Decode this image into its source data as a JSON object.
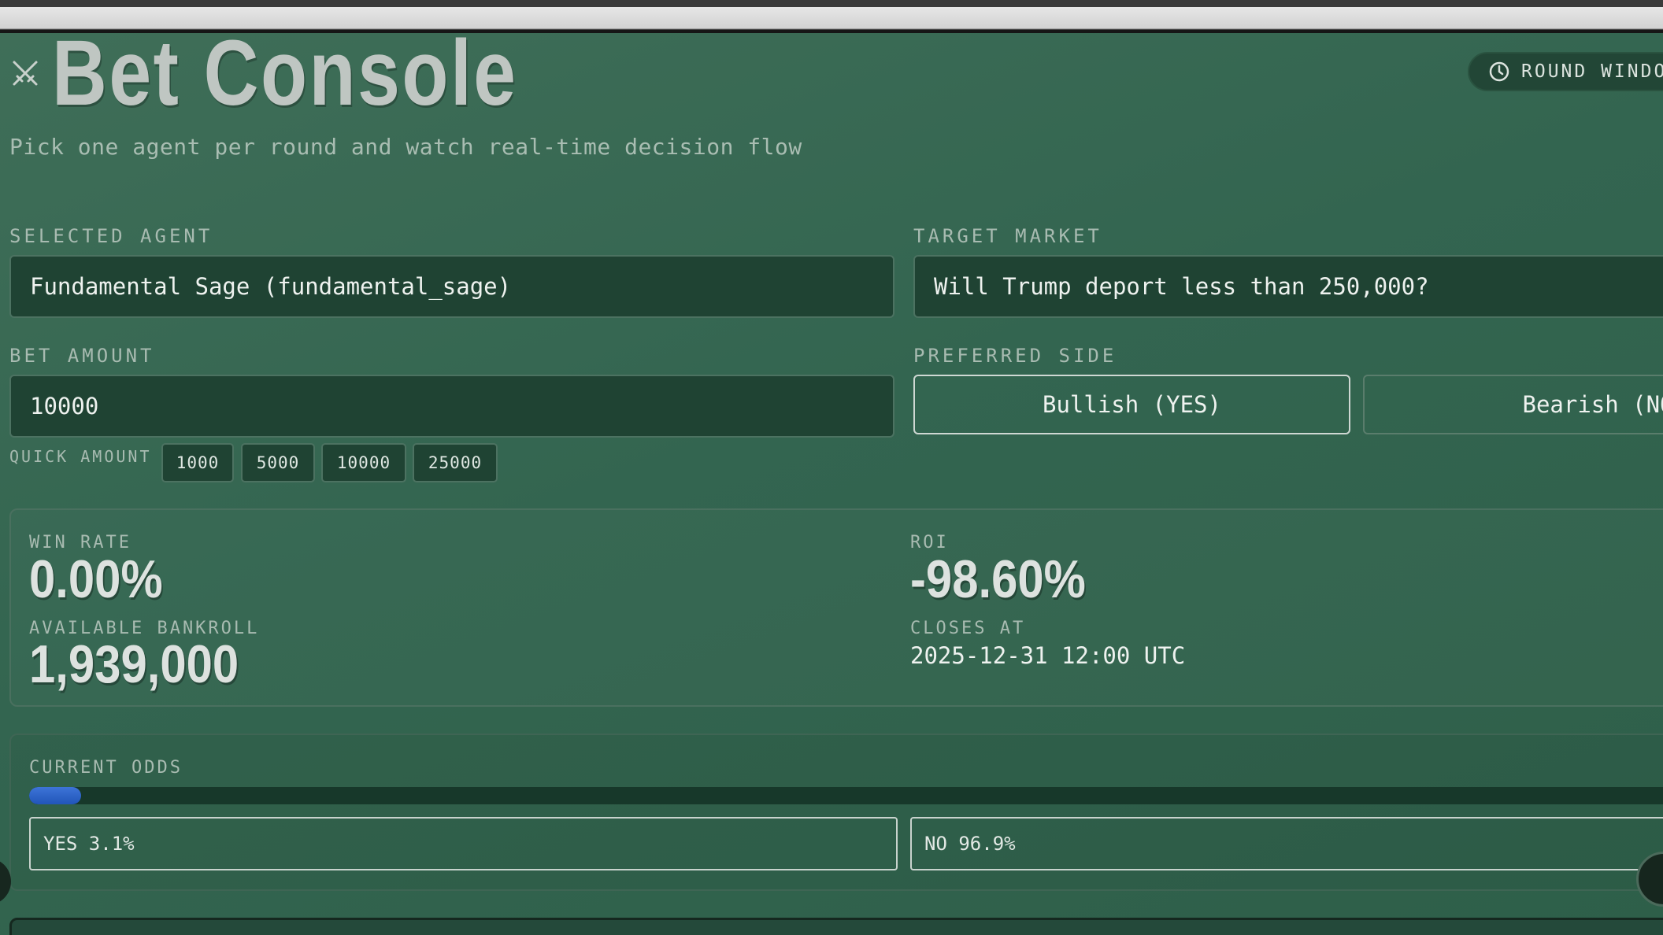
{
  "header": {
    "title": "Bet Console",
    "subtitle": "Pick one agent per round and watch real-time decision flow",
    "round_window_label": "ROUND WINDO",
    "title_icon": "crossed-swords-icon",
    "round_icon": "clock-icon"
  },
  "form": {
    "agent_label": "SELECTED AGENT",
    "agent_value": "Fundamental Sage (fundamental_sage)",
    "market_label": "TARGET MARKET",
    "market_value": "Will Trump deport less than 250,000?",
    "amount_label": "BET AMOUNT",
    "amount_value": "10000",
    "side_label": "PREFERRED SIDE",
    "side_yes": "Bullish (YES)",
    "side_no": "Bearish (NO)",
    "quick_label": "QUICK AMOUNT",
    "quick_amounts": [
      "1000",
      "5000",
      "10000",
      "25000"
    ]
  },
  "stats": {
    "win_rate_label": "WIN RATE",
    "win_rate_value": "0.00%",
    "roi_label": "ROI",
    "roi_value": "-98.60%",
    "bankroll_label": "AVAILABLE BANKROLL",
    "bankroll_value": "1,939,000",
    "closes_label": "CLOSES AT",
    "closes_value": "2025-12-31 12:00 UTC"
  },
  "odds": {
    "label": "CURRENT ODDS",
    "yes_text": "YES 3.1%",
    "no_text": "NO 96.9%",
    "yes_fraction": 0.031
  },
  "colors": {
    "background": "#2c5a44",
    "field": "#1f4333",
    "odds_fill": "#2f63c8"
  }
}
